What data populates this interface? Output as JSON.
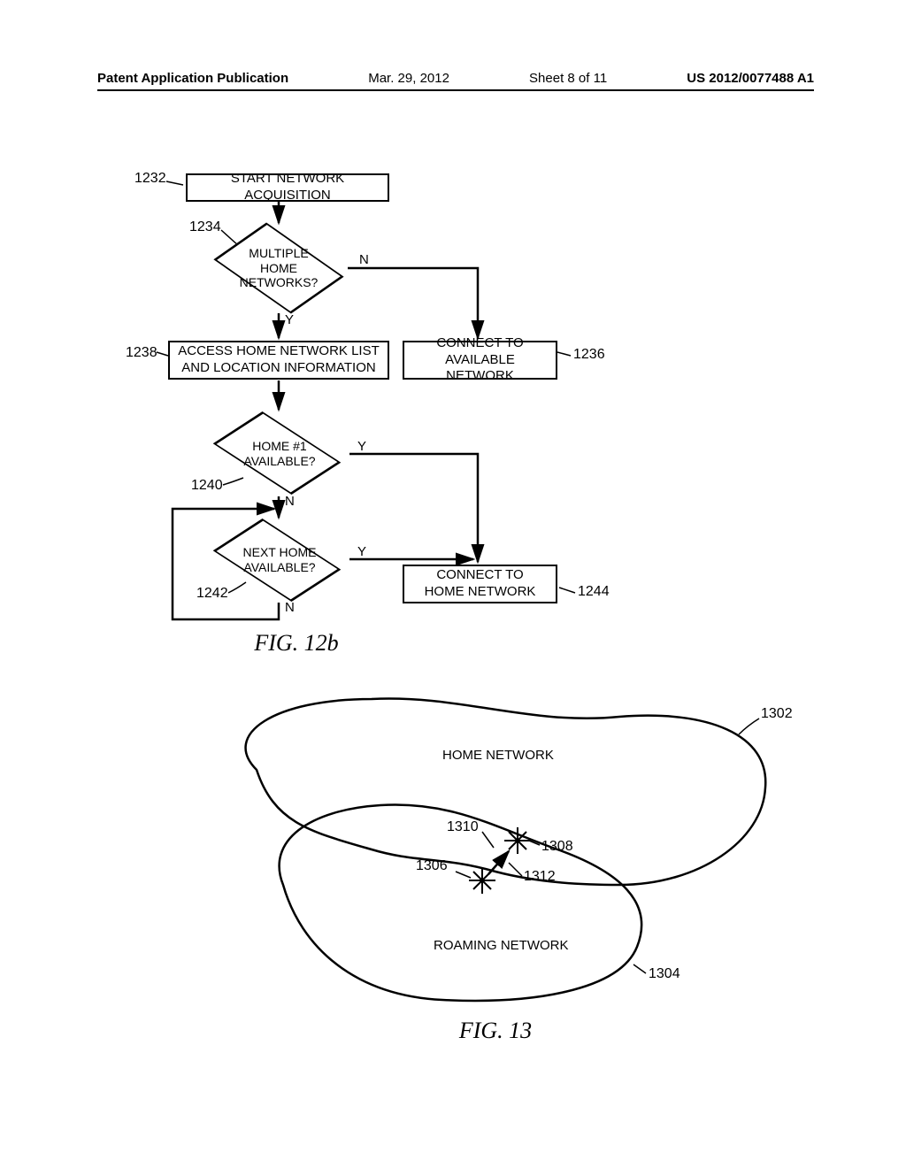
{
  "header": {
    "pub_label": "Patent Application Publication",
    "date": "Mar. 29, 2012",
    "sheet": "Sheet 8 of 11",
    "pubnum": "US 2012/0077488 A1"
  },
  "fig12b": {
    "caption": "FIG. 12b",
    "nodes": {
      "start": {
        "ref": "1232",
        "text": "START NETWORK ACQUISITION"
      },
      "multiple": {
        "ref": "1234",
        "text": "MULTIPLE\nHOME\nNETWORKS?",
        "yes": "Y",
        "no": "N"
      },
      "connect_avail": {
        "ref": "1236",
        "text": "CONNECT TO\nAVAILABLE NETWORK"
      },
      "access_list": {
        "ref": "1238",
        "text": "ACCESS HOME NETWORK LIST\nAND LOCATION INFORMATION"
      },
      "home1": {
        "ref": "1240",
        "text": "HOME #1\nAVAILABLE?",
        "yes": "Y",
        "no": "N"
      },
      "next_home": {
        "ref": "1242",
        "text": "NEXT HOME\nAVAILABLE?",
        "yes": "Y",
        "no": "N"
      },
      "connect_home": {
        "ref": "1244",
        "text": "CONNECT TO\nHOME NETWORK"
      }
    }
  },
  "fig13": {
    "caption": "FIG. 13",
    "labels": {
      "home": {
        "ref": "1302",
        "text": "HOME NETWORK"
      },
      "roaming": {
        "ref": "1304",
        "text": "ROAMING NETWORK"
      },
      "ref1306": "1306",
      "ref1308": "1308",
      "ref1310": "1310",
      "ref1312": "1312"
    }
  }
}
